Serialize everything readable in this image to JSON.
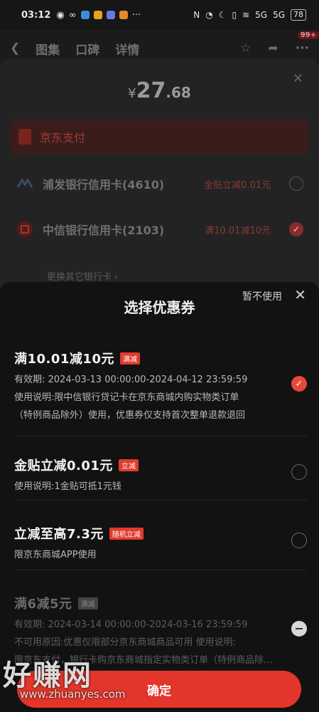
{
  "status_bar": {
    "time": "03:12",
    "signal_1": "5G",
    "signal_2": "5G",
    "battery": "78"
  },
  "nav": {
    "tab_gallery": "图集",
    "tab_reviews": "口碑",
    "tab_details": "详情",
    "badge": "99+"
  },
  "payment": {
    "currency": "¥",
    "amount_int": "27",
    "amount_dec": ".68",
    "method": "京东支付",
    "banks": [
      {
        "name": "浦发银行信用卡(4610)",
        "discount": "金贴立减0.01元",
        "selected": false
      },
      {
        "name": "中信银行信用卡(2103)",
        "discount": "满10.01减10元",
        "selected": true
      }
    ],
    "change_bank": "更换其它银行卡 ›"
  },
  "coupon_sheet": {
    "title": "选择优惠券",
    "no_use": "暂不使用",
    "coupons": [
      {
        "title": "满10.01减10元",
        "tag": "满减",
        "lines": [
          "有效期: 2024-03-13 00:00:00-2024-04-12 23:59:59",
          "使用说明:限中信银行贷记卡在京东商城内购实物类订单",
          "（特例商品除外）使用，优惠券仅支持首次整单退款退回"
        ],
        "state": "checked"
      },
      {
        "title": "金贴立减0.01元",
        "tag": "立减",
        "lines": [
          "使用说明:1金贴可抵1元钱"
        ],
        "state": "empty"
      },
      {
        "title": "立减至高7.3元",
        "tag": "随机立减",
        "lines": [
          "限京东商城APP使用"
        ],
        "state": "empty"
      },
      {
        "title": "满6减5元",
        "tag": "满减",
        "lines": [
          "有效期: 2024-03-14 00:00:00-2024-03-16 23:59:59",
          "不可用原因:优惠仅限部分京东商城商品可用  使用说明:",
          "限京东支付，银行卡购京东商城指定实物类订单（特例商品除外）"
        ],
        "state": "disabled"
      }
    ],
    "confirm": "确定"
  },
  "watermark": {
    "big": "好赚网",
    "small": "www.zhuanyes.com"
  },
  "colors": {
    "accent": "#e3352b",
    "sheet_bg": "#121212"
  }
}
